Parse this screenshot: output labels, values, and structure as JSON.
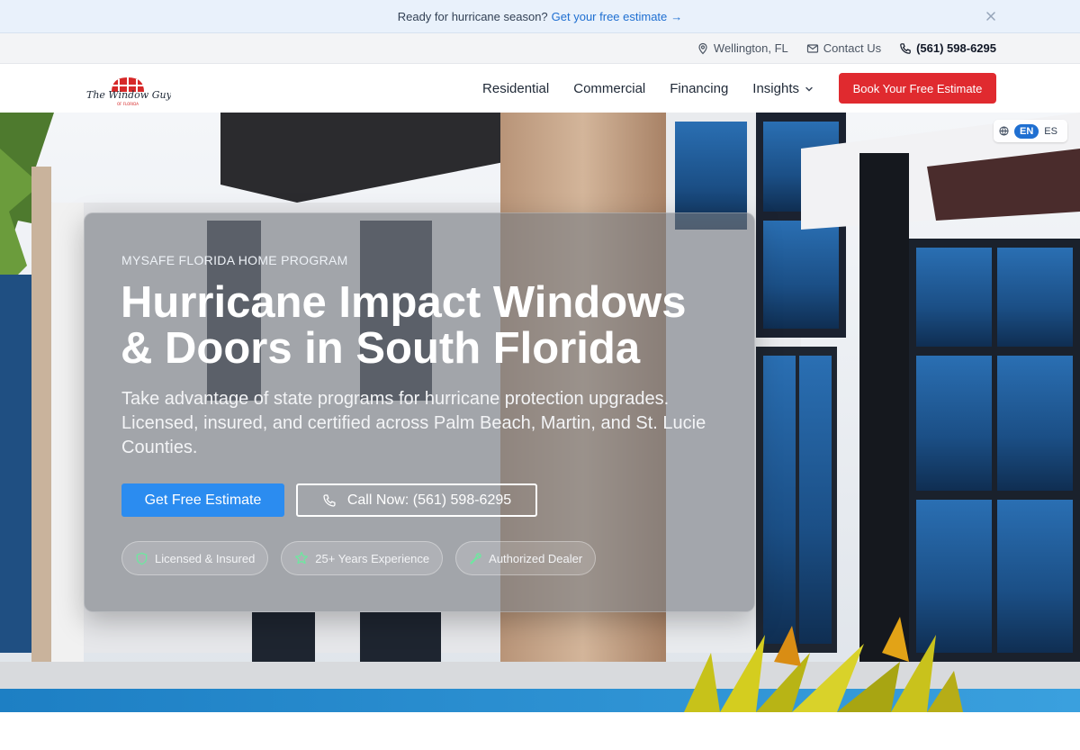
{
  "announcement": {
    "text": "Ready for hurricane season?",
    "link_label": "Get your free estimate",
    "link_arrow": "→"
  },
  "utility": {
    "location": "Wellington, FL",
    "contact": "Contact Us",
    "phone": "(561) 598-6295"
  },
  "nav": {
    "logo_text": "The Window Guys",
    "logo_subtext": "OF FLORIDA",
    "links": [
      "Residential",
      "Commercial",
      "Financing",
      "Insights"
    ],
    "cta": "Book Your Free Estimate"
  },
  "language": {
    "active": "EN",
    "other": "ES"
  },
  "hero": {
    "eyebrow": "MYSAFE FLORIDA HOME PROGRAM",
    "title_line1": "Hurricane Impact Windows",
    "title_line2": "& Doors in South Florida",
    "subtitle": "Take advantage of state programs for hurricane protection upgrades. Licensed, insured, and certified across Palm Beach, Martin, and St. Lucie Counties.",
    "primary_cta": "Get Free Estimate",
    "secondary_cta": "Call Now: (561) 598-6295",
    "badges": [
      "Licensed & Insured",
      "25+ Years Experience",
      "Authorized Dealer"
    ]
  },
  "colors": {
    "brand_red": "#e02a2f",
    "accent_blue": "#2b8cf0",
    "link_blue": "#1f6fd1",
    "badge_icon_green": "#6ee7a0"
  },
  "icons": [
    "close-icon",
    "arrow-right-icon",
    "map-pin-icon",
    "mail-icon",
    "phone-icon",
    "chevron-down-icon",
    "globe-icon",
    "shield-icon",
    "star-icon",
    "wrench-icon"
  ]
}
